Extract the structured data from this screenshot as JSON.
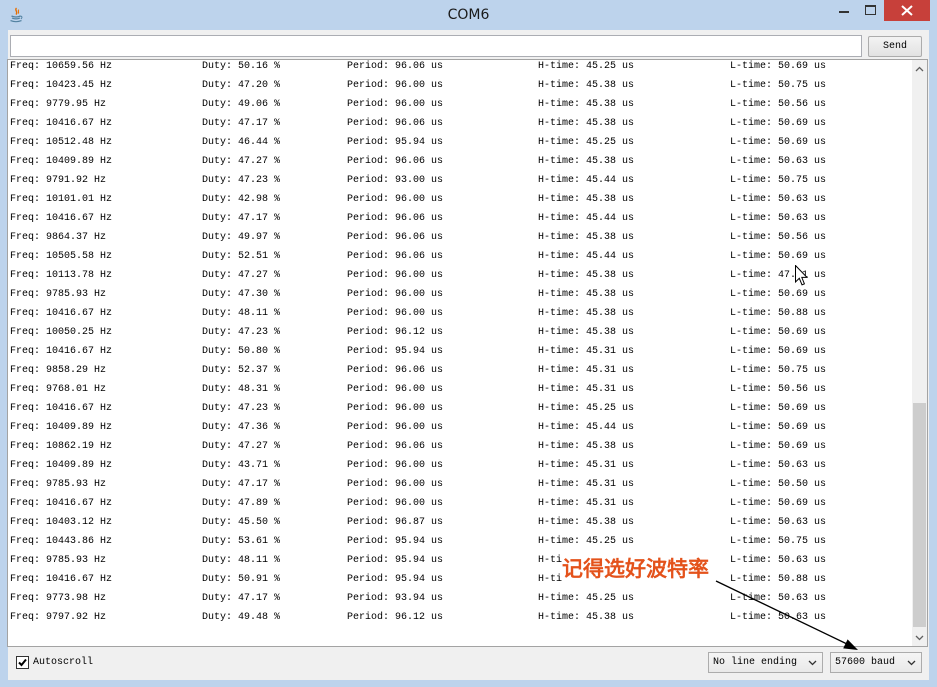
{
  "window": {
    "title": "COM6",
    "icons": {
      "app": "java-icon",
      "minimize": "minimize-icon",
      "maximize": "maximize-icon",
      "close": "close-icon"
    }
  },
  "input": {
    "value": "",
    "placeholder": ""
  },
  "toolbar": {
    "send_label": "Send"
  },
  "output": {
    "columns": [
      "freq",
      "duty",
      "period",
      "h_time",
      "l_time"
    ],
    "lines": [
      [
        "Freq: 10659.56 Hz",
        "Duty: 50.16 %",
        "Period: 96.06 us",
        "H-time: 45.25 us",
        "L-time: 50.69 us"
      ],
      [
        "Freq: 10423.45 Hz",
        "Duty: 47.20 %",
        "Period: 96.00 us",
        "H-time: 45.38 us",
        "L-time: 50.75 us"
      ],
      [
        "Freq: 9779.95 Hz",
        "Duty: 49.06 %",
        "Period: 96.00 us",
        "H-time: 45.38 us",
        "L-time: 50.56 us"
      ],
      [
        "Freq: 10416.67 Hz",
        "Duty: 47.17 %",
        "Period: 96.06 us",
        "H-time: 45.38 us",
        "L-time: 50.69 us"
      ],
      [
        "Freq: 10512.48 Hz",
        "Duty: 46.44 %",
        "Period: 95.94 us",
        "H-time: 45.25 us",
        "L-time: 50.69 us"
      ],
      [
        "Freq: 10409.89 Hz",
        "Duty: 47.27 %",
        "Period: 96.06 us",
        "H-time: 45.38 us",
        "L-time: 50.63 us"
      ],
      [
        "Freq: 9791.92 Hz",
        "Duty: 47.23 %",
        "Period: 93.00 us",
        "H-time: 45.44 us",
        "L-time: 50.75 us"
      ],
      [
        "Freq: 10101.01 Hz",
        "Duty: 42.98 %",
        "Period: 96.00 us",
        "H-time: 45.38 us",
        "L-time: 50.63 us"
      ],
      [
        "Freq: 10416.67 Hz",
        "Duty: 47.17 %",
        "Period: 96.06 us",
        "H-time: 45.44 us",
        "L-time: 50.63 us"
      ],
      [
        "Freq: 9864.37 Hz",
        "Duty: 49.97 %",
        "Period: 96.06 us",
        "H-time: 45.38 us",
        "L-time: 50.56 us"
      ],
      [
        "Freq: 10505.58 Hz",
        "Duty: 52.51 %",
        "Period: 96.06 us",
        "H-time: 45.44 us",
        "L-time: 50.69 us"
      ],
      [
        "Freq: 10113.78 Hz",
        "Duty: 47.27 %",
        "Period: 96.00 us",
        "H-time: 45.38 us",
        "L-time: 47. 1 us"
      ],
      [
        "Freq: 9785.93 Hz",
        "Duty: 47.30 %",
        "Period: 96.00 us",
        "H-time: 45.38 us",
        "L-time: 50.69 us"
      ],
      [
        "Freq: 10416.67 Hz",
        "Duty: 48.11 %",
        "Period: 96.00 us",
        "H-time: 45.38 us",
        "L-time: 50.88 us"
      ],
      [
        "Freq: 10050.25 Hz",
        "Duty: 47.23 %",
        "Period: 96.12 us",
        "H-time: 45.38 us",
        "L-time: 50.69 us"
      ],
      [
        "Freq: 10416.67 Hz",
        "Duty: 50.80 %",
        "Period: 95.94 us",
        "H-time: 45.31 us",
        "L-time: 50.69 us"
      ],
      [
        "Freq: 9858.29 Hz",
        "Duty: 52.37 %",
        "Period: 96.06 us",
        "H-time: 45.31 us",
        "L-time: 50.75 us"
      ],
      [
        "Freq: 9768.01 Hz",
        "Duty: 48.31 %",
        "Period: 96.00 us",
        "H-time: 45.31 us",
        "L-time: 50.56 us"
      ],
      [
        "Freq: 10416.67 Hz",
        "Duty: 47.23 %",
        "Period: 96.00 us",
        "H-time: 45.25 us",
        "L-time: 50.69 us"
      ],
      [
        "Freq: 10409.89 Hz",
        "Duty: 47.36 %",
        "Period: 96.00 us",
        "H-time: 45.44 us",
        "L-time: 50.69 us"
      ],
      [
        "Freq: 10862.19 Hz",
        "Duty: 47.27 %",
        "Period: 96.06 us",
        "H-time: 45.38 us",
        "L-time: 50.69 us"
      ],
      [
        "Freq: 10409.89 Hz",
        "Duty: 43.71 %",
        "Period: 96.00 us",
        "H-time: 45.31 us",
        "L-time: 50.63 us"
      ],
      [
        "Freq: 9785.93 Hz",
        "Duty: 47.17 %",
        "Period: 96.00 us",
        "H-time: 45.31 us",
        "L-time: 50.50 us"
      ],
      [
        "Freq: 10416.67 Hz",
        "Duty: 47.89 %",
        "Period: 96.00 us",
        "H-time: 45.31 us",
        "L-time: 50.69 us"
      ],
      [
        "Freq: 10403.12 Hz",
        "Duty: 45.50 %",
        "Period: 96.87 us",
        "H-time: 45.38 us",
        "L-time: 50.63 us"
      ],
      [
        "Freq: 10443.86 Hz",
        "Duty: 53.61 %",
        "Period: 95.94 us",
        "H-time: 45.25 us",
        "L-time: 50.75 us"
      ],
      [
        "Freq: 9785.93 Hz",
        "Duty: 48.11 %",
        "Period: 95.94 us",
        "H-ti",
        "L-time: 50.63 us"
      ],
      [
        "Freq: 10416.67 Hz",
        "Duty: 50.91 %",
        "Period: 95.94 us",
        "H-ti",
        "L-time: 50.88 us"
      ],
      [
        "Freq: 9773.98 Hz",
        "Duty: 47.17 %",
        "Period: 93.94 us",
        "H-time: 45.25 us",
        "L-time: 50.63 us"
      ],
      [
        "Freq: 9797.92 Hz",
        "Duty: 49.48 %",
        "Period: 96.12 us",
        "H-time: 45.38 us",
        "L-time: 50.63 us"
      ]
    ]
  },
  "footer": {
    "autoscroll_label": "Autoscroll",
    "autoscroll_checked": true,
    "line_ending": "No line ending",
    "baud_rate": "57600 baud"
  },
  "annotation": {
    "text": "记得选好波特率"
  },
  "colors": {
    "frame": "#bdd3ec",
    "close_button": "#c7403a",
    "annotation": "#e4521b",
    "output_text": "#000000"
  }
}
